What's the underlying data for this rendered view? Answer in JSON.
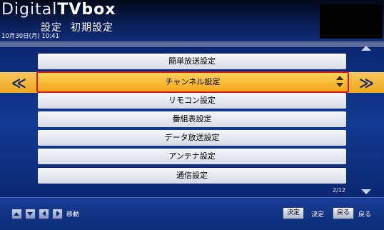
{
  "header": {
    "brand_light": "Digital",
    "brand_bold": "TVbox",
    "title": "設定",
    "subtitle": "初期設定",
    "datetime": "10月30日(月) 10:41"
  },
  "menu": {
    "items": [
      {
        "label": "簡単放送設定"
      },
      {
        "label": "チャンネル設定",
        "selected": true
      },
      {
        "label": "リモコン設定"
      },
      {
        "label": "番組表設定"
      },
      {
        "label": "データ放送設定"
      },
      {
        "label": "アンテナ設定"
      },
      {
        "label": "通信設定"
      }
    ],
    "page_counter": "2/12",
    "left_chevron": "≪",
    "right_chevron": "≫"
  },
  "footer": {
    "move_label": "移動",
    "confirm_key": "決定",
    "confirm_label": "決定",
    "back_key": "戻る",
    "back_label": "戻る"
  },
  "colors": {
    "accent": "#f2a61a",
    "selection_border": "#cf1a1a",
    "background": "#123a8f"
  }
}
